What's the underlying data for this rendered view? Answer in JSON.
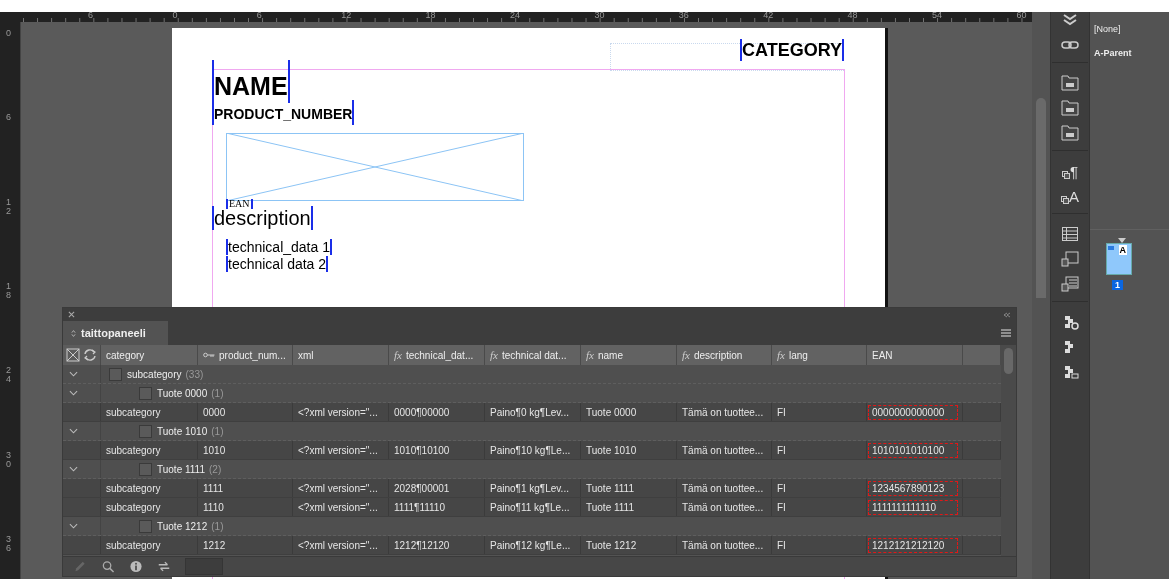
{
  "rulers": {
    "horizontal": [
      "6",
      "0",
      "6",
      "12",
      "18",
      "24",
      "30",
      "36",
      "42",
      "48",
      "54",
      "60"
    ],
    "vertical": [
      "0",
      "6",
      "12",
      "18",
      "24",
      "30",
      "36"
    ]
  },
  "document": {
    "category": "CATEGORY",
    "name": "NAME",
    "product_number": "PRODUCT_NUMBER",
    "ean": "EAN",
    "description": "description",
    "technical_data": [
      "technical_data 1",
      "technical data 2"
    ]
  },
  "tools": [
    {
      "kind": "chevrons"
    },
    {
      "kind": "link"
    },
    {
      "kind": "folder"
    },
    {
      "kind": "folder"
    },
    {
      "kind": "folder"
    },
    {
      "kind": "glyph",
      "glyph": "¶"
    },
    {
      "kind": "glyph",
      "glyph": "A"
    },
    {
      "kind": "table"
    },
    {
      "kind": "frames"
    },
    {
      "kind": "frames-list"
    },
    {
      "kind": "puzzle-gear"
    },
    {
      "kind": "puzzle"
    },
    {
      "kind": "puzzle-list"
    }
  ],
  "pages_panel": {
    "parents": [
      "[None]",
      "A-Parent"
    ],
    "thumbnail_parent": "A",
    "page_number": "1"
  },
  "data_panel": {
    "title": "taittopaneeli",
    "columns": [
      {
        "label": "category",
        "kind": "plain"
      },
      {
        "label": "product_num...",
        "kind": "key"
      },
      {
        "label": "xml",
        "kind": "plain"
      },
      {
        "label": "technical_dat...",
        "kind": "formula",
        "prefix": "fx"
      },
      {
        "label": "technical dat...",
        "kind": "formula",
        "prefix": "fx"
      },
      {
        "label": "name",
        "kind": "formula",
        "prefix": "fx"
      },
      {
        "label": "description",
        "kind": "formula",
        "prefix": "fx"
      },
      {
        "label": "lang",
        "kind": "formula",
        "prefix": "fx"
      },
      {
        "label": "EAN",
        "kind": "plain"
      }
    ],
    "groups": [
      {
        "label": "subcategory",
        "count": "(33)",
        "expanded": true,
        "checked": false,
        "children": [
          {
            "label": "Tuote 0000",
            "count": "(1)",
            "expanded": true,
            "checked": false,
            "records": [
              {
                "cells": [
                  "subcategory",
                  "0000",
                  "<?xml version=\"...",
                  "0000¶00000",
                  "Paino¶0 kg¶Lev...",
                  "Tuote 0000",
                  "Tämä on tuottee...",
                  "FI",
                  "0000000000000"
                ],
                "ean_flagged": true
              }
            ]
          },
          {
            "label": "Tuote 1010",
            "count": "(1)",
            "expanded": true,
            "checked": false,
            "records": [
              {
                "cells": [
                  "subcategory",
                  "1010",
                  "<?xml version=\"...",
                  "1010¶10100",
                  "Paino¶10 kg¶Le...",
                  "Tuote 1010",
                  "Tämä on tuottee...",
                  "FI",
                  "1010101010100"
                ],
                "ean_flagged": true
              }
            ]
          },
          {
            "label": "Tuote 1111",
            "count": "(2)",
            "expanded": true,
            "checked": false,
            "records": [
              {
                "cells": [
                  "subcategory",
                  "1111",
                  "<?xml version=\"...",
                  "2028¶00001",
                  "Paino¶1 kg¶Lev...",
                  "Tuote 1111",
                  "Tämä on tuottee...",
                  "FI",
                  "1234567890123"
                ],
                "ean_flagged": true
              },
              {
                "cells": [
                  "subcategory",
                  "1110",
                  "<?xml version=\"...",
                  "1111¶11110",
                  "Paino¶11 kg¶Le...",
                  "Tuote 1111",
                  "Tämä on tuottee...",
                  "FI",
                  "1111111111110"
                ],
                "ean_flagged": true
              }
            ]
          },
          {
            "label": "Tuote 1212",
            "count": "(1)",
            "expanded": true,
            "checked": false,
            "records": [
              {
                "cells": [
                  "subcategory",
                  "1212",
                  "<?xml version=\"...",
                  "1212¶12120",
                  "Paino¶12 kg¶Le...",
                  "Tuote 1212",
                  "Tämä on tuottee...",
                  "FI",
                  "1212121212120"
                ],
                "ean_flagged": true
              }
            ]
          }
        ]
      }
    ]
  }
}
